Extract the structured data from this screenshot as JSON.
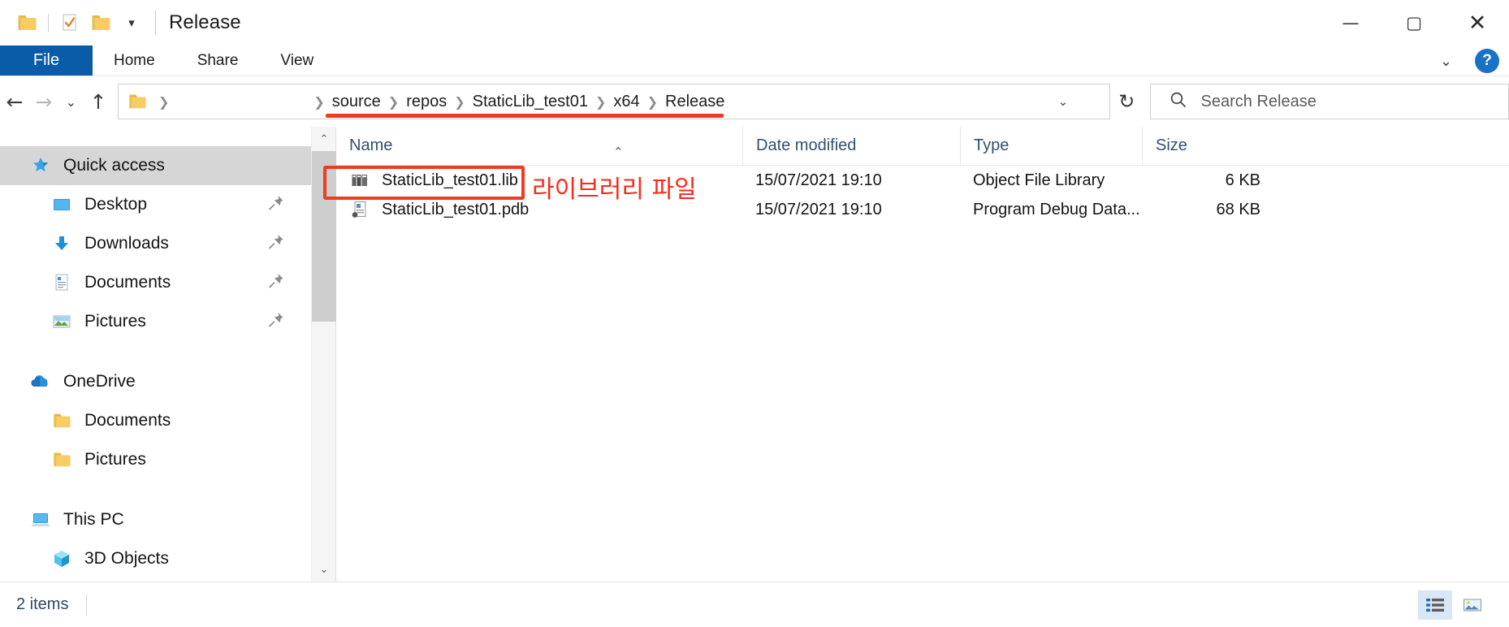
{
  "window": {
    "title": "Release",
    "quick_access_icons": [
      "folder-icon",
      "properties-icon",
      "new-folder-icon"
    ],
    "customize_label": "▾",
    "caption": {
      "minimize": "—",
      "maximize": "▢",
      "close": "✕"
    }
  },
  "ribbon": {
    "tabs": [
      {
        "label": "File",
        "active": true
      },
      {
        "label": "Home",
        "active": false
      },
      {
        "label": "Share",
        "active": false
      },
      {
        "label": "View",
        "active": false
      }
    ],
    "expand_label": "⌄",
    "help_label": "?"
  },
  "navigation": {
    "back_label": "←",
    "forward_label": "→",
    "recent_label": "⌄",
    "up_label": "↑",
    "breadcrumb": {
      "root_icon": "folder-icon",
      "separator": "❯",
      "items": [
        "source",
        "repos",
        "StaticLib_test01",
        "x64",
        "Release"
      ]
    },
    "dropdown_label": "⌄",
    "refresh_label": "↻"
  },
  "search": {
    "placeholder": "Search Release",
    "icon": "search-icon"
  },
  "sidebar": {
    "items": [
      {
        "label": "Quick access",
        "icon": "pin-star-icon",
        "level": 1,
        "selected": true,
        "pinned": false
      },
      {
        "label": "Desktop",
        "icon": "desktop-icon",
        "level": 2,
        "selected": false,
        "pinned": true
      },
      {
        "label": "Downloads",
        "icon": "download-icon",
        "level": 2,
        "selected": false,
        "pinned": true
      },
      {
        "label": "Documents",
        "icon": "document-icon",
        "level": 2,
        "selected": false,
        "pinned": true
      },
      {
        "label": "Pictures",
        "icon": "pictures-icon",
        "level": 2,
        "selected": false,
        "pinned": true
      },
      {
        "label": "OneDrive",
        "icon": "cloud-icon",
        "level": 1,
        "selected": false,
        "pinned": false,
        "spacer_before": true
      },
      {
        "label": "Documents",
        "icon": "folder-icon",
        "level": 2,
        "selected": false,
        "pinned": false
      },
      {
        "label": "Pictures",
        "icon": "folder-icon",
        "level": 2,
        "selected": false,
        "pinned": false
      },
      {
        "label": "This PC",
        "icon": "computer-icon",
        "level": 1,
        "selected": false,
        "pinned": false,
        "spacer_before": true
      },
      {
        "label": "3D Objects",
        "icon": "cube-icon",
        "level": 2,
        "selected": false,
        "pinned": false
      }
    ],
    "scroll": {
      "up_arrow": "⌃",
      "down_arrow": "⌄"
    }
  },
  "file_list": {
    "sort_indicator": "⌃",
    "columns": [
      {
        "key": "name",
        "label": "Name"
      },
      {
        "key": "date",
        "label": "Date modified"
      },
      {
        "key": "type",
        "label": "Type"
      },
      {
        "key": "size",
        "label": "Size"
      }
    ],
    "rows": [
      {
        "name": "StaticLib_test01.lib",
        "date": "15/07/2021 19:10",
        "type": "Object File Library",
        "size": "6 KB",
        "icon": "library-file-icon"
      },
      {
        "name": "StaticLib_test01.pdb",
        "date": "15/07/2021 19:10",
        "type": "Program Debug Data...",
        "size": "68 KB",
        "icon": "pdb-file-icon"
      }
    ]
  },
  "status_bar": {
    "item_count": "2 items",
    "view_buttons": [
      {
        "name": "details-view",
        "active": true
      },
      {
        "name": "large-icons-view",
        "active": false
      }
    ]
  },
  "annotations": {
    "highlight_color": "#ef3b21",
    "library_note": "라이브러리 파일"
  }
}
